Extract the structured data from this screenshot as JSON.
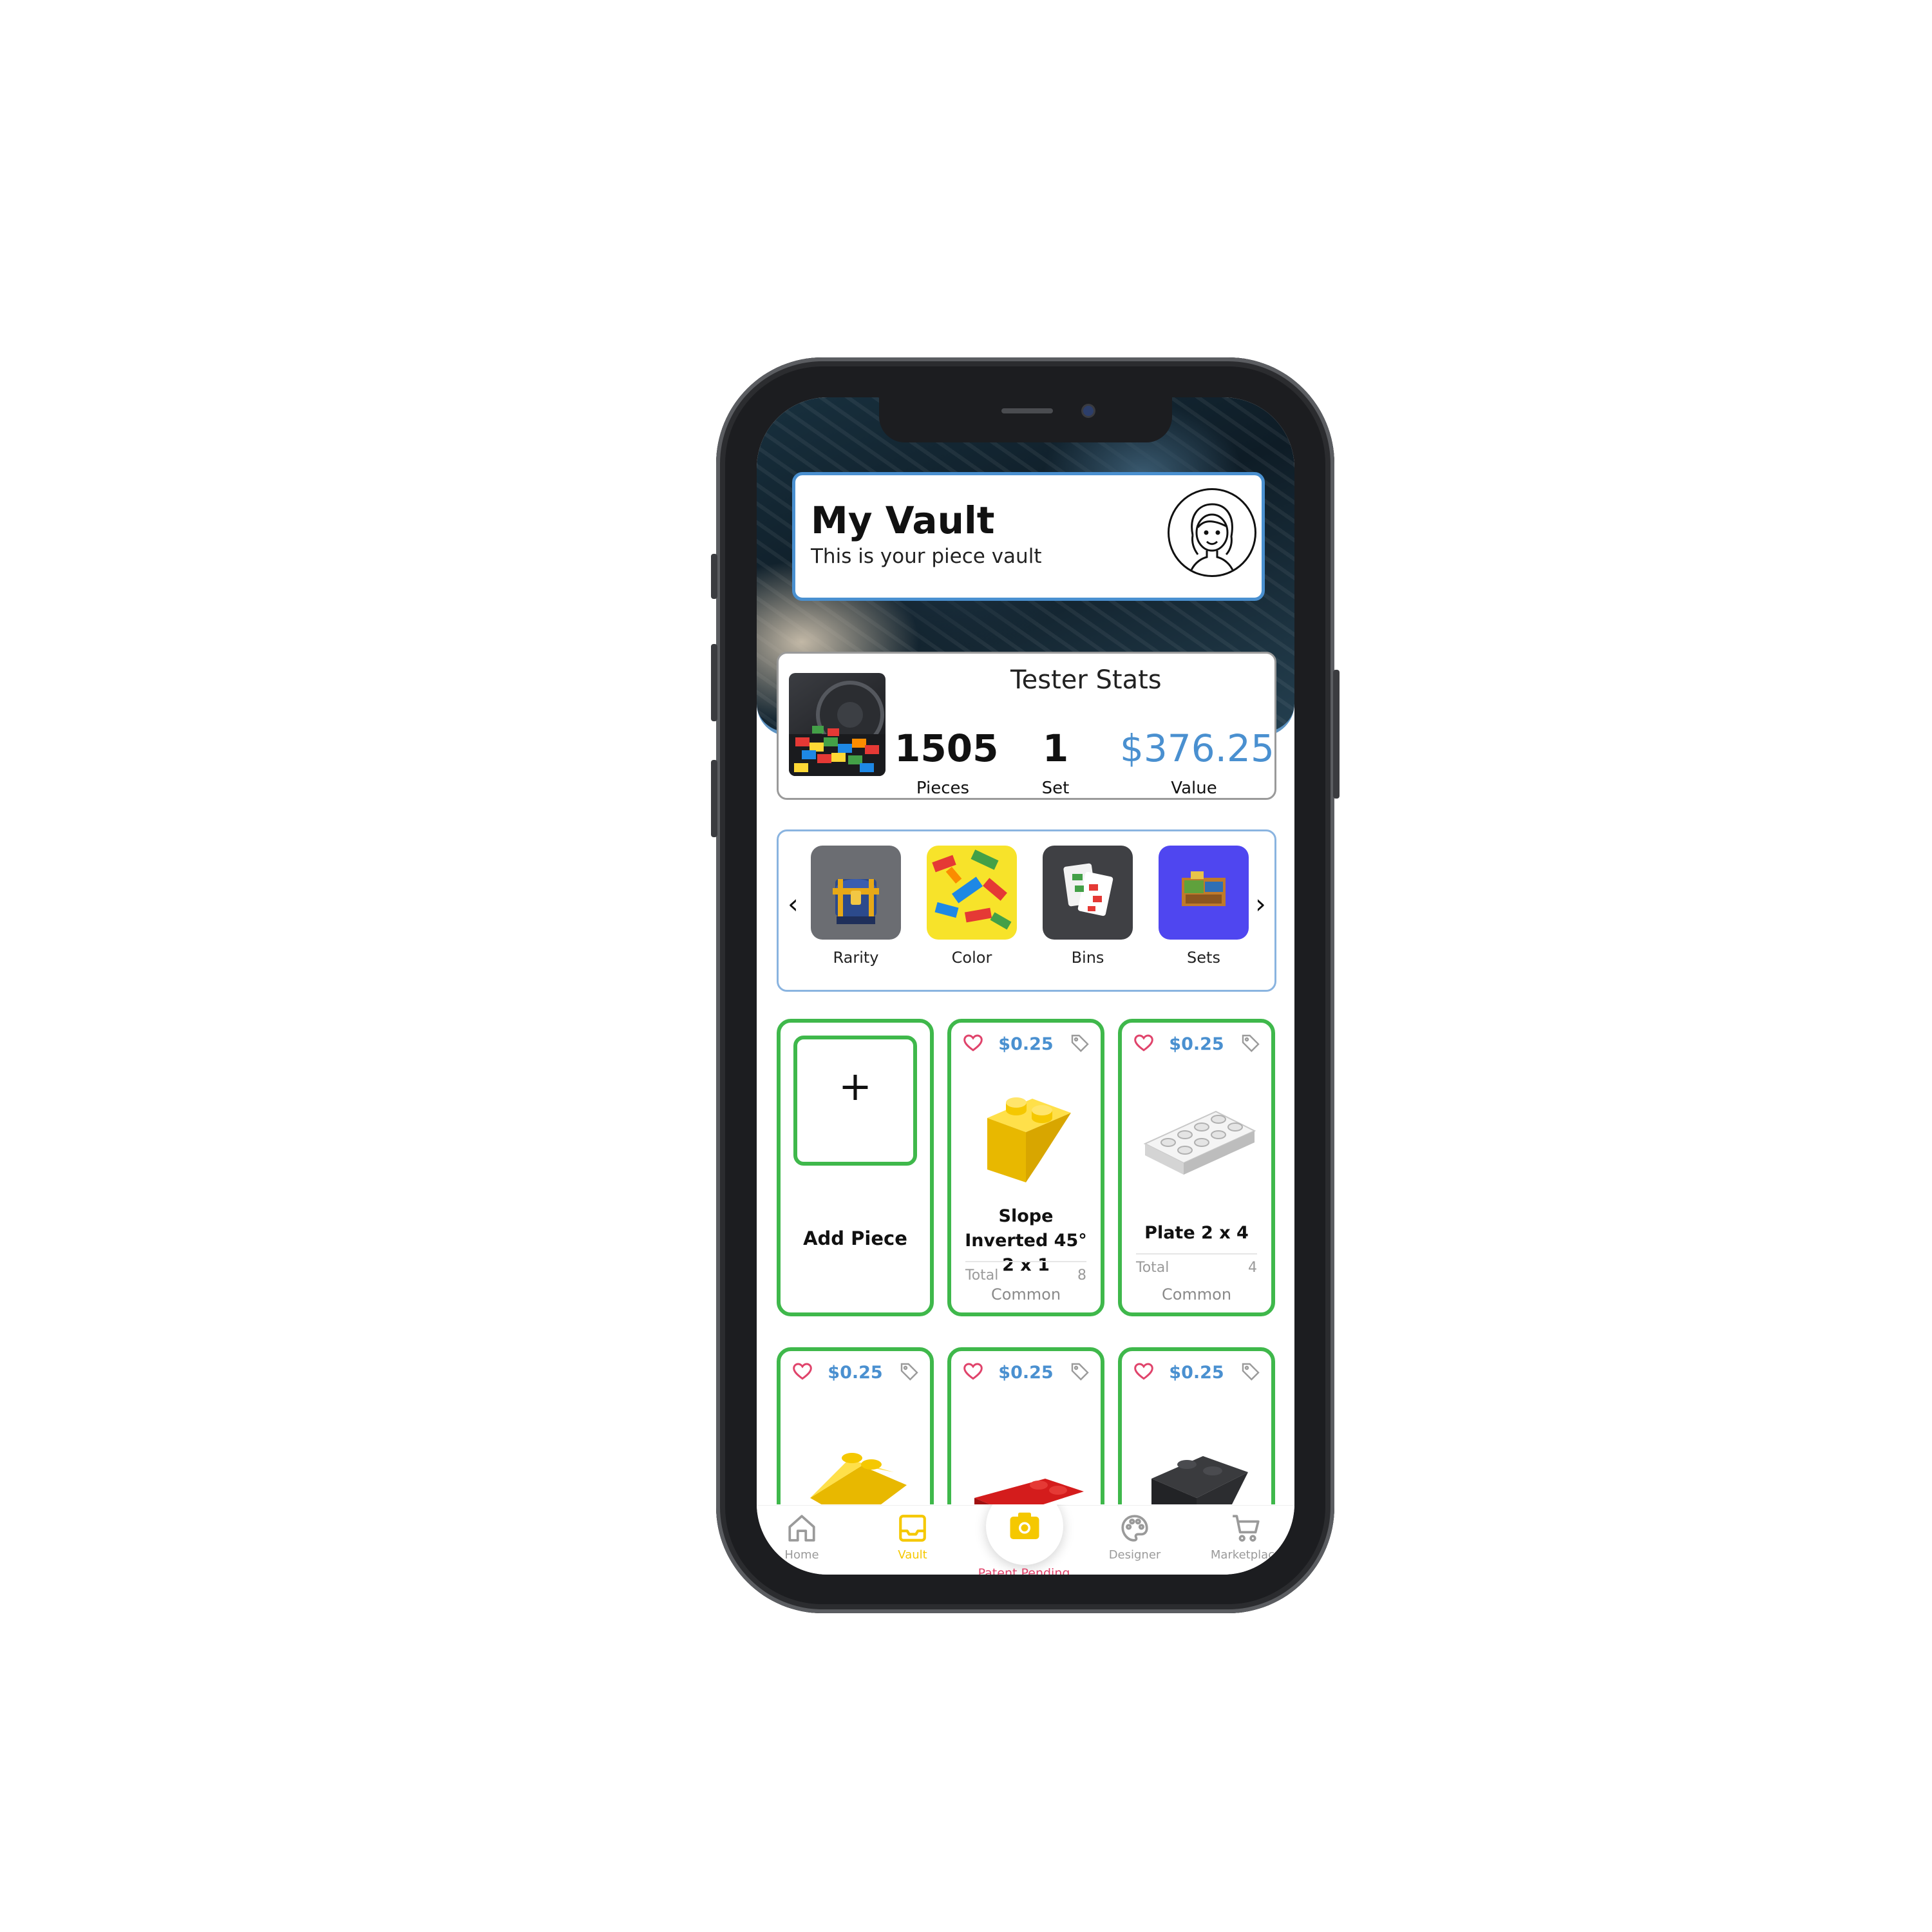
{
  "header": {
    "title": "My Vault",
    "subtitle": "This is your piece vault"
  },
  "stats": {
    "title": "Tester Stats",
    "pieces": {
      "value": "1505",
      "label": "Pieces"
    },
    "sets": {
      "value": "1",
      "label": "Set"
    },
    "value": {
      "value": "$376.25",
      "label": "Value"
    }
  },
  "categories": {
    "prev_arrow": "‹",
    "next_arrow": "›",
    "items": [
      {
        "label": "Rarity"
      },
      {
        "label": "Color"
      },
      {
        "label": "Bins"
      },
      {
        "label": "Sets"
      }
    ]
  },
  "add_piece": {
    "plus": "+",
    "label": "Add Piece"
  },
  "pieces": [
    {
      "price": "$0.25",
      "name": "Slope Inverted 45° 2 x 1",
      "total_label": "Total",
      "total": "8",
      "rarity": "Common",
      "color": "#f5c800"
    },
    {
      "price": "$0.25",
      "name": "Plate 2 x 4",
      "total_label": "Total",
      "total": "4",
      "rarity": "Common",
      "color": "#e6e6e6"
    },
    {
      "price": "$0.25",
      "color": "#f5c800"
    },
    {
      "price": "$0.25",
      "color": "#cc1616"
    },
    {
      "price": "$0.25",
      "color": "#2a2b2d"
    }
  ],
  "nav": {
    "items": [
      {
        "label": "Home",
        "icon": "home-icon"
      },
      {
        "label": "Vault",
        "icon": "inbox-icon"
      },
      {
        "label": "Designer",
        "icon": "palette-icon"
      },
      {
        "label": "Marketplace",
        "icon": "cart-icon"
      }
    ],
    "camera_caption": "Patent Pending"
  },
  "colors": {
    "accent_blue": "#4a90d0",
    "card_green": "#3fb84b",
    "active_nav": "#f5c800",
    "heart_red": "#e0436b"
  }
}
